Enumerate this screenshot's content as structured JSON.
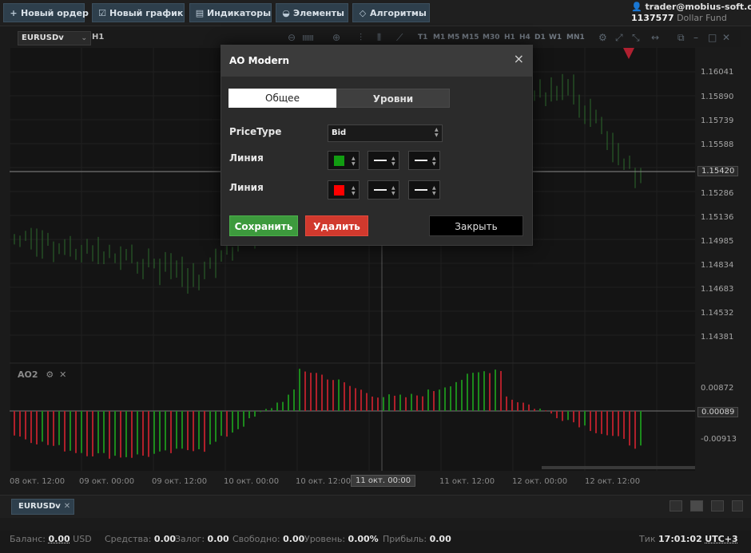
{
  "toolbar": {
    "new_order": "Новый ордер",
    "new_chart": "Новый график",
    "indicators": "Индикаторы",
    "elements": "Элементы",
    "algorithms": "Алгоритмы"
  },
  "account": {
    "email": "trader@mobius-soft.org",
    "number": "1137577",
    "fund": "Dollar Fund"
  },
  "chart_header": {
    "symbol": "EURUSDv",
    "timeframe": "H1",
    "timeframes": [
      "T1",
      "M1",
      "M5",
      "M15",
      "M30",
      "H1",
      "H4",
      "D1",
      "W1",
      "MN1"
    ]
  },
  "price_axis": {
    "labels": [
      "1.16041",
      "1.15890",
      "1.15739",
      "1.15588",
      "1.15420",
      "1.15286",
      "1.15136",
      "1.14985",
      "1.14834",
      "1.14683",
      "1.14532",
      "1.14381"
    ],
    "ao_labels": [
      "0.00872",
      "0.00089",
      "-0.00913"
    ]
  },
  "time_axis": {
    "labels": [
      "08 окт. 12:00",
      "09 окт. 00:00",
      "09 окт. 12:00",
      "10 окт. 00:00",
      "10 окт. 12:00",
      "11 окт. 00:00",
      "11 окт. 12:00",
      "12 окт. 00:00",
      "12 окт. 12:00"
    ]
  },
  "indicator_panel": {
    "name": "AO2",
    "settings_icon": "⚙",
    "close_icon": "✕"
  },
  "dialog": {
    "title": "AO Modern",
    "close": "×",
    "tabs": [
      "Общее",
      "Уровни"
    ],
    "price_type_label": "PriceType",
    "price_type_value": "Bid",
    "line1_label": "Линия",
    "line2_label": "Линия",
    "line1_color": "#119c11",
    "line2_color": "#ff0000",
    "save": "Сохранить",
    "delete": "Удалить",
    "close_button": "Закрыть"
  },
  "tabs": {
    "symbol": "EURUSDv",
    "close": "✕"
  },
  "status": {
    "balance_label": "Баланс:",
    "balance_value": "0.00",
    "currency": "USD",
    "equity_label": "Средства:",
    "equity_value": "0.00",
    "margin_label": "Залог:",
    "margin_value": "0.00",
    "free_label": "Свободно:",
    "free_value": "0.00",
    "level_label": "Уровень:",
    "level_value": "0.00%",
    "profit_label": "Прибыль:",
    "profit_value": "0.00",
    "tick_label": "Тик",
    "tick_time": "17:01:02",
    "timezone": "UTC+3"
  },
  "colors": {
    "up_bar": "#1c8a1c",
    "down_bar": "#b0202a",
    "candle": "#2d6a2d",
    "price_line": "#8a8a8a",
    "accent": "#2e3f4c"
  }
}
